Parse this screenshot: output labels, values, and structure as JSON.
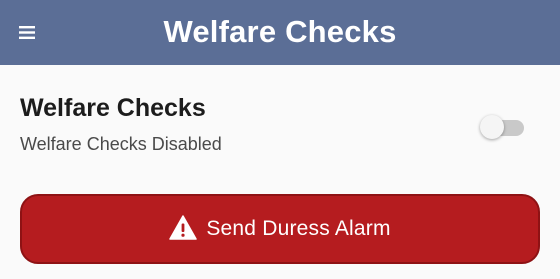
{
  "header": {
    "title": "Welfare Checks",
    "menu_icon": "hamburger-menu-icon",
    "background_color": "#5b6e96"
  },
  "welfare_setting": {
    "title": "Welfare Checks",
    "status": "Welfare Checks Disabled",
    "toggle_on": false
  },
  "alarm_button": {
    "label": "Send Duress Alarm",
    "icon": "warning-triangle-icon",
    "color": "#b51c1f"
  }
}
